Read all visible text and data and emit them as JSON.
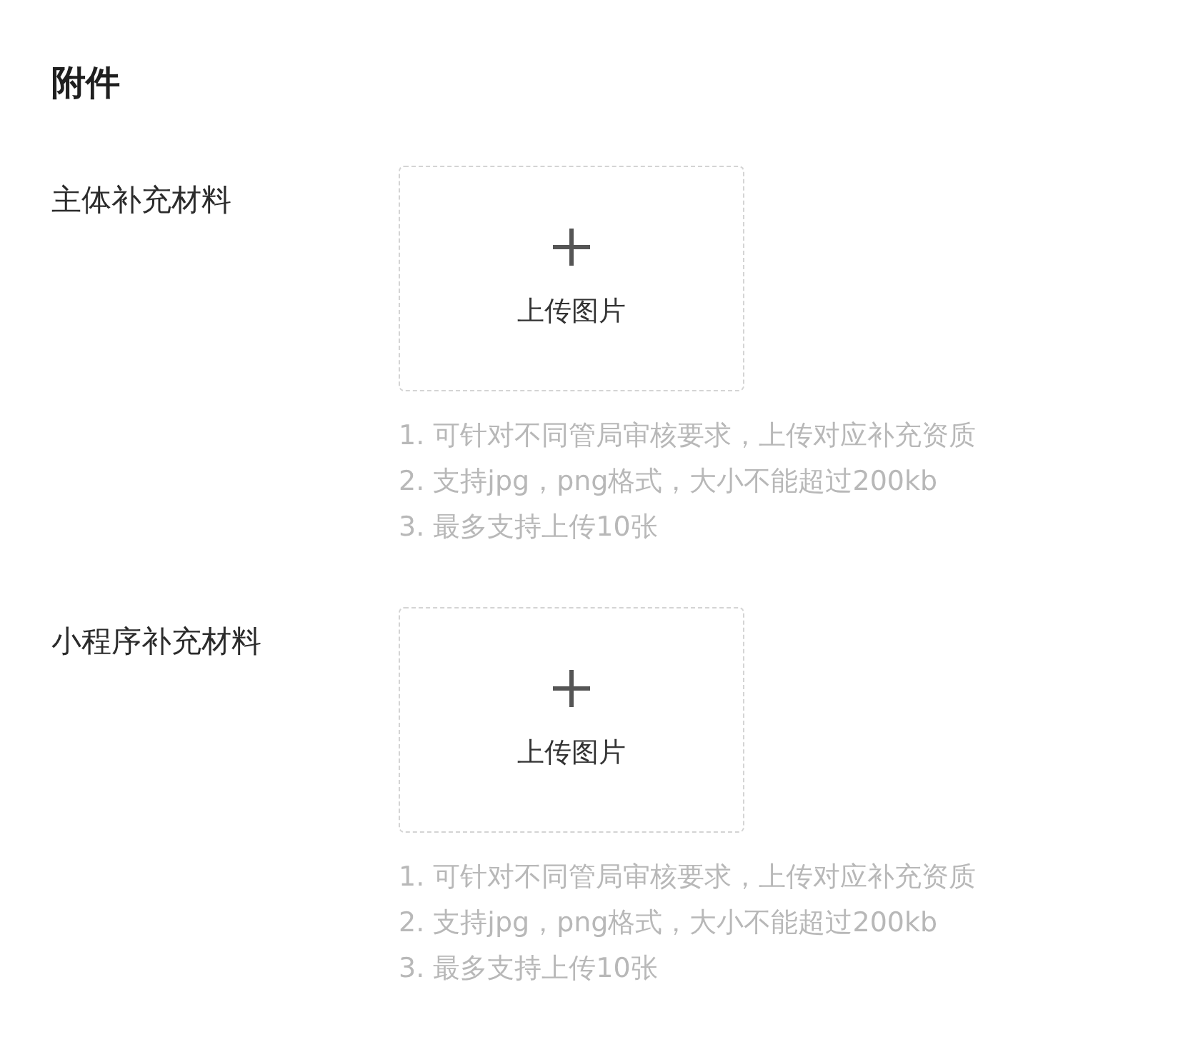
{
  "heading": "附件",
  "sections": [
    {
      "label": "主体补充材料",
      "upload": {
        "label": "上传图片"
      },
      "hints": [
        "1. 可针对不同管局审核要求，上传对应补充资质",
        "2. 支持jpg，png格式，大小不能超过200kb",
        "3. 最多支持上传10张"
      ]
    },
    {
      "label": "小程序补充材料",
      "upload": {
        "label": "上传图片"
      },
      "hints": [
        "1. 可针对不同管局审核要求，上传对应补充资质",
        "2. 支持jpg，png格式，大小不能超过200kb",
        "3. 最多支持上传10张"
      ]
    }
  ]
}
